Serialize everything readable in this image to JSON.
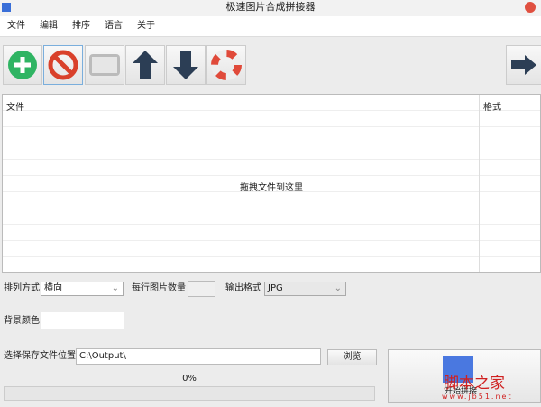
{
  "window": {
    "title": "极速图片合成拼接器"
  },
  "menu": [
    "文件",
    "编辑",
    "排序",
    "语言",
    "关于"
  ],
  "toolbar": {
    "buttons": [
      "add-icon",
      "clear-icon",
      "grid-icon",
      "up-arrow-icon",
      "down-arrow-icon",
      "help-icon"
    ],
    "next": "right-arrow-icon"
  },
  "table": {
    "columns": [
      "文件",
      "格式"
    ],
    "placeholder": "拖拽文件到这里"
  },
  "options": {
    "arrange_label": "排列方式",
    "arrange_value": "横向",
    "per_row_label": "每行图片数量",
    "per_row_value": "",
    "format_label": "输出格式",
    "format_value": "JPG",
    "bg_label": "背景颜色"
  },
  "save": {
    "label": "选择保存文件位置",
    "path": "C:\\Output\\",
    "browse": "浏览"
  },
  "progress": {
    "text": "0%",
    "value": 0
  },
  "start": {
    "label": "开始拼接"
  },
  "watermark": {
    "text": "脚本之家",
    "url": "www.jb51.net"
  }
}
